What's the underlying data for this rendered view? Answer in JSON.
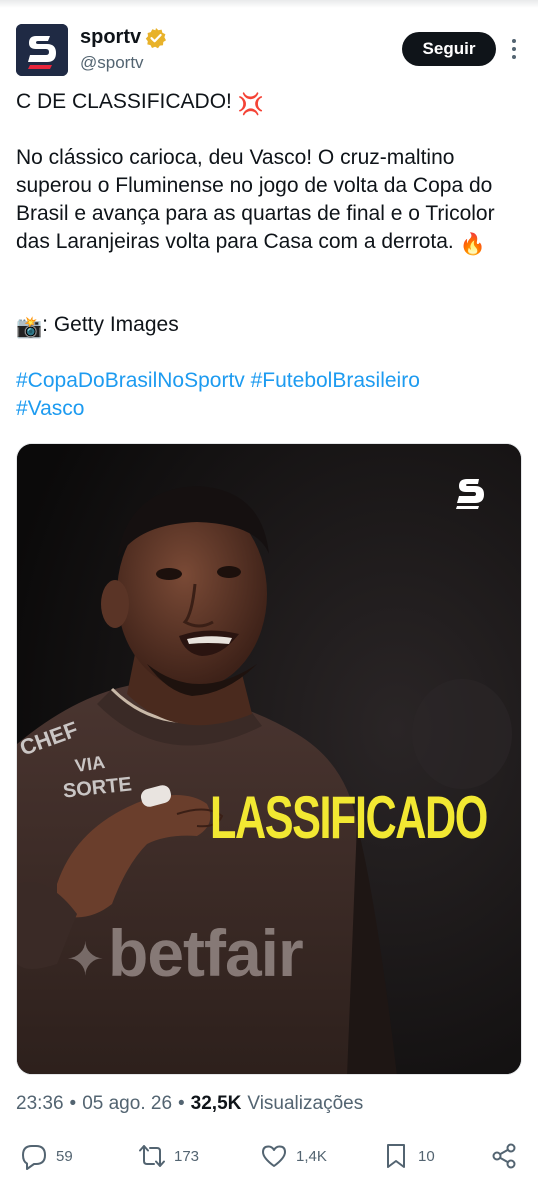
{
  "account": {
    "name": "sportv",
    "handle": "@sportv",
    "verified_color": "#e8b22a",
    "avatar_bg": "#1f2a44",
    "avatar_icon": "sportv-logo"
  },
  "header": {
    "follow_label": "Seguir",
    "more_icon": "more-vertical-icon"
  },
  "tweet": {
    "line1": "C DE CLASSIFICADO! ",
    "line1_emoji": "💢",
    "body": "No clássico carioca, deu Vasco! O cruz-maltino superou o Fluminense no jogo de volta da Copa do Brasil e avança para as quartas de final e o Tricolor das Laranjeiras volta para Casa com a derrota. ",
    "body_emoji": "🔥",
    "credit_emoji": "📸",
    "credit": ": Getty Images",
    "hashtags": [
      "#CopaDoBrasilNoSportv",
      "#FutebolBrasileiro",
      "#Vasco"
    ]
  },
  "media": {
    "overlay_text": "LASSIFICADO",
    "overlay_color": "#f2e832",
    "sponsor": "betfair",
    "shirt_text_1": "CHEF",
    "shirt_text_2": "VIA",
    "shirt_text_3": "SORTE",
    "logo_icon": "sportv-logo"
  },
  "meta": {
    "time": "23:36",
    "sep1": "•",
    "date": "05 ago. 26",
    "sep2": "•",
    "views": "32,5K",
    "views_label": "Visualizações"
  },
  "actions": {
    "replies": "59",
    "reposts": "173",
    "likes": "1,4K",
    "bookmarks": "10"
  }
}
